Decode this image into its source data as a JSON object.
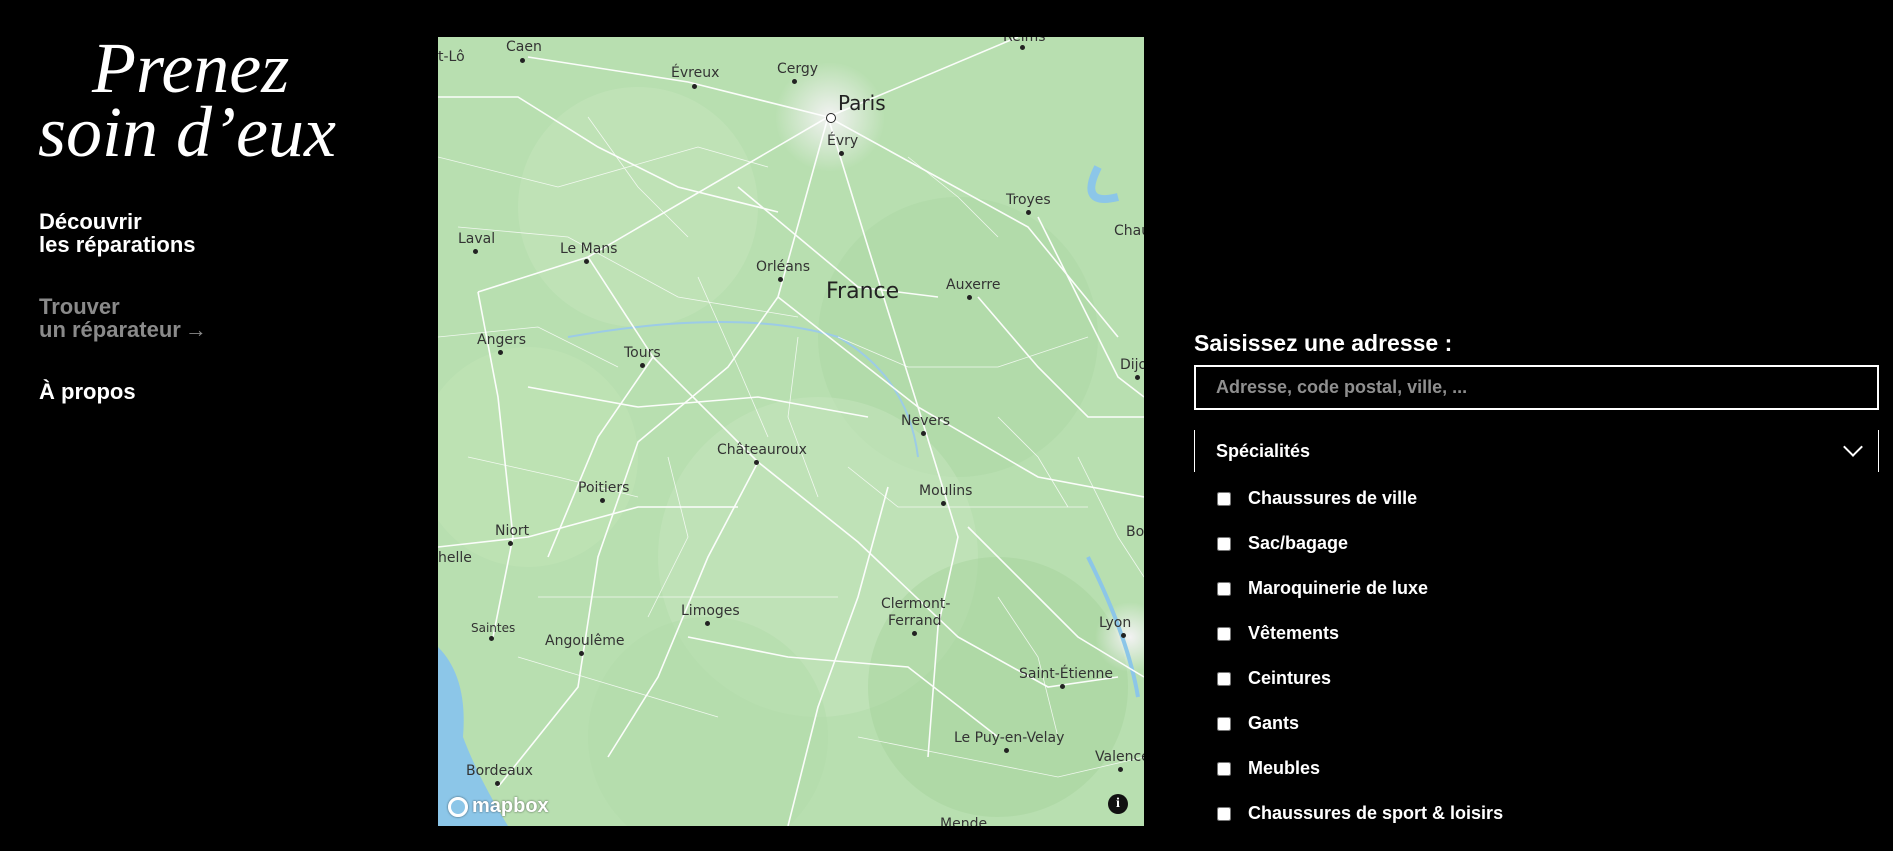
{
  "brand": {
    "line1": "Prenez",
    "line2": "soin d’eux"
  },
  "nav": {
    "discover": {
      "line1": "Découvrir",
      "line2": "les réparations"
    },
    "find": {
      "line1": "Trouver",
      "line2": "un réparateur",
      "arrow_icon": "arrow-right-icon"
    },
    "about": {
      "label": "À propos"
    }
  },
  "map": {
    "country": "France",
    "cities": [
      "Caen",
      "Évreux",
      "Cergy",
      "Paris",
      "Évry",
      "Reims",
      "Troyes",
      "Chau",
      "Laval",
      "Le Mans",
      "Orléans",
      "Auxerre",
      "Angers",
      "Tours",
      "Dijo",
      "Nevers",
      "Châteauroux",
      "Poitiers",
      "Moulins",
      "Niort",
      "helle",
      "Bo",
      "Saintes",
      "Limoges",
      "Clermont-",
      "Ferrand",
      "Lyon",
      "Angoulême",
      "Saint-Étienne",
      "Le Puy-en-Velay",
      "Valence",
      "Bordeaux",
      "Mende",
      "t-Lô"
    ],
    "attribution": "mapbox",
    "info_icon": "info-icon"
  },
  "search": {
    "label": "Saisissez une adresse :",
    "placeholder": "Adresse, code postal, ville, ..."
  },
  "specialties": {
    "title": "Spécialités",
    "items": [
      "Chaussures de ville",
      "Sac/bagage",
      "Maroquinerie de luxe",
      "Vêtements",
      "Ceintures",
      "Gants",
      "Meubles",
      "Chaussures de sport & loisirs"
    ]
  },
  "colors": {
    "background": "#000000",
    "text": "#ffffff",
    "muted": "#8a8a8a",
    "map_green": "#b8dfb0"
  }
}
